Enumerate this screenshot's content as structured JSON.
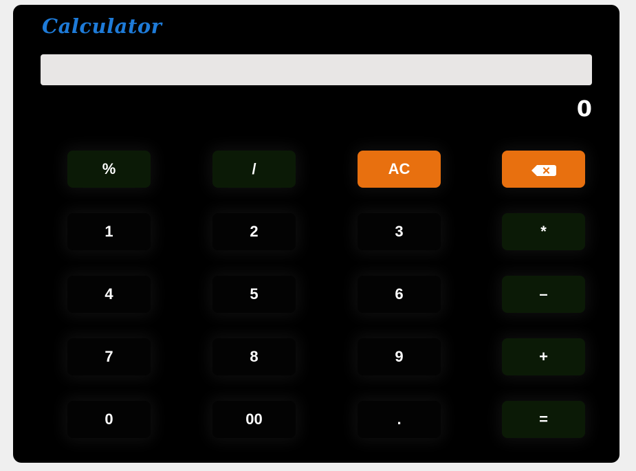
{
  "app": {
    "title": "Calculator"
  },
  "display": {
    "input_value": "",
    "result": "0"
  },
  "buttons": {
    "percent": "%",
    "divide": "/",
    "clear": "AC",
    "one": "1",
    "two": "2",
    "three": "3",
    "multiply": "*",
    "four": "4",
    "five": "5",
    "six": "6",
    "subtract": "–",
    "seven": "7",
    "eight": "8",
    "nine": "9",
    "add": "+",
    "zero": "0",
    "double_zero": "00",
    "decimal": ".",
    "equals": "="
  },
  "icons": {
    "backspace": "backspace-icon"
  },
  "colors": {
    "title": "#1e7bd8",
    "accent_orange": "#e8700f",
    "operator_bg": "#0b1a06",
    "number_bg": "#030303",
    "panel_bg": "#000000",
    "display_bg": "#e8e6e5"
  }
}
